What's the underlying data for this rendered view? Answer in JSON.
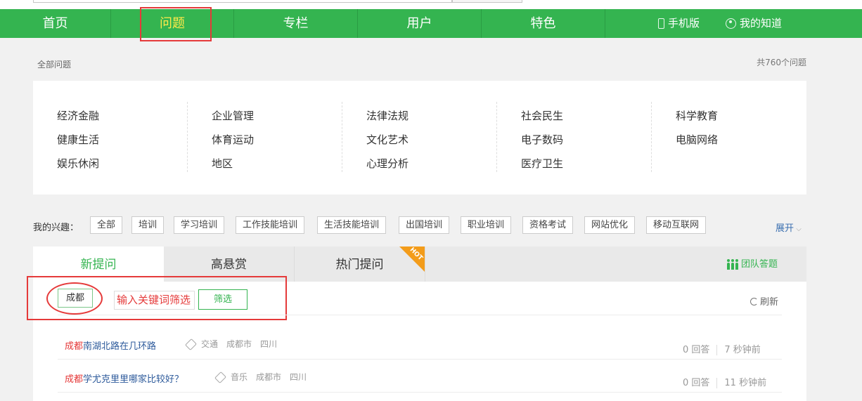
{
  "nav": {
    "items": [
      {
        "label": "首页",
        "active": false
      },
      {
        "label": "问题",
        "active": true
      },
      {
        "label": "专栏",
        "active": false
      },
      {
        "label": "用户",
        "active": false
      },
      {
        "label": "特色",
        "active": false
      }
    ],
    "mobile": "手机版",
    "mine": "我的知道",
    "color": "#34b450",
    "active_color": "#ffe94a"
  },
  "header": {
    "breadcrumb": "全部问题",
    "count": "共760个问题"
  },
  "categories": [
    [
      "经济金融",
      "健康生活",
      "娱乐休闲"
    ],
    [
      "企业管理",
      "体育运动",
      "地区"
    ],
    [
      "法律法规",
      "文化艺术",
      "心理分析"
    ],
    [
      "社会民生",
      "电子数码",
      "医疗卫生"
    ],
    [
      "科学教育",
      "电脑网络"
    ]
  ],
  "interests": {
    "label": "我的兴趣：",
    "tags": [
      "全部",
      "培训",
      "学习培训",
      "工作技能培训",
      "生活技能培训",
      "出国培训",
      "职业培训",
      "资格考试",
      "网站优化",
      "移动互联网"
    ],
    "expand": "展开"
  },
  "tabs": {
    "items": [
      "新提问",
      "高悬赏",
      "热门提问"
    ],
    "hot_badge": "HOT",
    "team": "团队答题"
  },
  "filter": {
    "tag": "成都",
    "input_value": "输入关键词筛选",
    "button": "筛选",
    "refresh": "刷新"
  },
  "questions": [
    {
      "highlight": "成都",
      "title": "南湖北路在几环路",
      "tags": [
        "交通",
        "成都市",
        "四川"
      ],
      "answers": "0 回答",
      "time": "7 秒钟前"
    },
    {
      "highlight": "成都",
      "title": "学尤克里里哪家比较好？",
      "tags": [
        "音乐",
        "成都市",
        "四川"
      ],
      "answers": "0 回答",
      "time": "11 秒钟前"
    }
  ]
}
